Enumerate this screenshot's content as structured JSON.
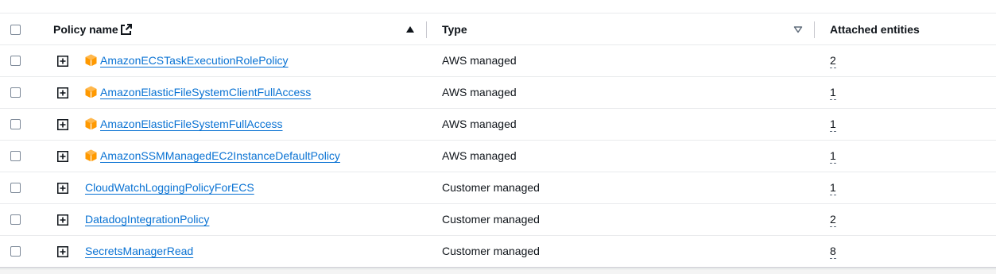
{
  "header": {
    "policy_name": "Policy name",
    "type": "Type",
    "attached_entities": "Attached entities"
  },
  "rows": [
    {
      "name": "AmazonECSTaskExecutionRolePolicy",
      "type": "AWS managed",
      "count": "2",
      "aws": true
    },
    {
      "name": "AmazonElasticFileSystemClientFullAccess",
      "type": "AWS managed",
      "count": "1",
      "aws": true
    },
    {
      "name": "AmazonElasticFileSystemFullAccess",
      "type": "AWS managed",
      "count": "1",
      "aws": true
    },
    {
      "name": "AmazonSSMManagedEC2InstanceDefaultPolicy",
      "type": "AWS managed",
      "count": "1",
      "aws": true
    },
    {
      "name": "CloudWatchLoggingPolicyForECS",
      "type": "Customer managed",
      "count": "1",
      "aws": false
    },
    {
      "name": "DatadogIntegrationPolicy",
      "type": "Customer managed",
      "count": "2",
      "aws": false
    },
    {
      "name": "SecretsManagerRead",
      "type": "Customer managed",
      "count": "8",
      "aws": false
    }
  ],
  "icons": {
    "external_link": "external-link-icon",
    "sort_ascending": "sort-ascending-icon",
    "sort_descending": "sort-descending-icon",
    "expand": "expand-plus-icon",
    "aws_managed": "aws-cube-icon"
  },
  "colors": {
    "link": "#0972d3",
    "aws_orange": "#ff9900",
    "text": "#0f141a",
    "divider": "#c6c6cd"
  }
}
